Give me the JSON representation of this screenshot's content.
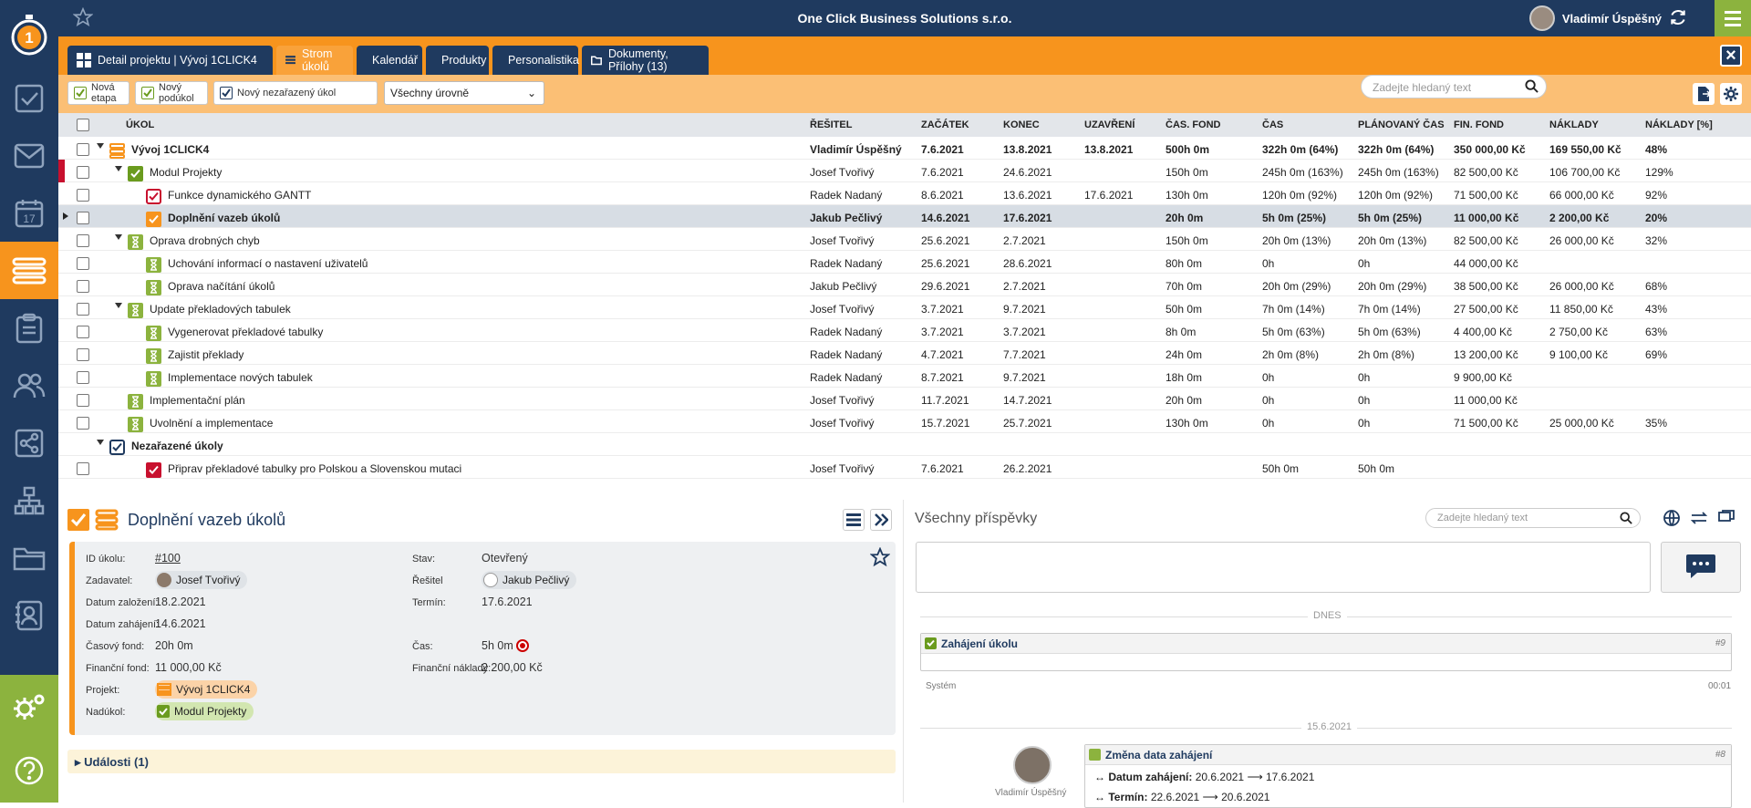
{
  "app": {
    "company": "One Click Business Solutions s.r.o.",
    "user": "Vladimír Úspěšný"
  },
  "tabs": [
    {
      "label": "Detail projektu | Vývoj 1CLICK4"
    },
    {
      "label": "Strom úkolů"
    },
    {
      "label": "Kalendář"
    },
    {
      "label": "Produkty"
    },
    {
      "label": "Personalistika"
    },
    {
      "label": "Dokumenty, Přílohy (13)"
    }
  ],
  "toolbar": {
    "new_stage": "Nová etapa",
    "new_subtask": "Nový podúkol",
    "new_unassigned": "Nový nezařazený úkol",
    "level_select": "Všechny úrovně",
    "search_placeholder": "Zadejte hledaný text"
  },
  "columns": [
    "ÚKOL",
    "ŘEŠITEL",
    "ZAČÁTEK",
    "KONEC",
    "UZAVŘENÍ",
    "ČAS. FOND",
    "ČAS",
    "PLÁNOVANÝ ČAS",
    "FIN. FOND",
    "NÁKLADY",
    "NÁKLADY [%]"
  ],
  "rows": [
    {
      "name": "Vývoj 1CLICK4",
      "solver": "Vladimír Úspěšný",
      "start": "7.6.2021",
      "end": "13.8.2021",
      "closed": "13.8.2021",
      "fund": "500h 0m",
      "time": "322h 0m (64%)",
      "planned": "322h 0m (64%)",
      "fin": "350 000,00 Kč",
      "costs": "169 550,00 Kč",
      "pct": "48%"
    },
    {
      "name": "Modul Projekty",
      "solver": "Josef Tvořivý",
      "start": "7.6.2021",
      "end": "24.6.2021",
      "closed": "",
      "fund": "150h 0m",
      "time": "245h 0m (163%)",
      "planned": "245h 0m (163%)",
      "fin": "82 500,00 Kč",
      "costs": "106 700,00 Kč",
      "pct": "129%"
    },
    {
      "name": "Funkce dynamického GANTT",
      "solver": "Radek Nadaný",
      "start": "8.6.2021",
      "end": "13.6.2021",
      "closed": "17.6.2021",
      "fund": "130h 0m",
      "time": "120h 0m (92%)",
      "planned": "120h 0m (92%)",
      "fin": "71 500,00 Kč",
      "costs": "66 000,00 Kč",
      "pct": "92%"
    },
    {
      "name": "Doplnění vazeb úkolů",
      "solver": "Jakub Pečlivý",
      "start": "14.6.2021",
      "end": "17.6.2021",
      "closed": "",
      "fund": "20h 0m",
      "time": "5h 0m (25%)",
      "planned": "5h 0m (25%)",
      "fin": "11 000,00 Kč",
      "costs": "2 200,00 Kč",
      "pct": "20%"
    },
    {
      "name": "Oprava drobných chyb",
      "solver": "Josef Tvořivý",
      "start": "25.6.2021",
      "end": "2.7.2021",
      "closed": "",
      "fund": "150h 0m",
      "time": "20h 0m (13%)",
      "planned": "20h 0m (13%)",
      "fin": "82 500,00 Kč",
      "costs": "26 000,00 Kč",
      "pct": "32%"
    },
    {
      "name": "Uchování informací o nastavení uživatelů",
      "solver": "Radek Nadaný",
      "start": "25.6.2021",
      "end": "28.6.2021",
      "closed": "",
      "fund": "80h 0m",
      "time": "0h",
      "planned": "0h",
      "fin": "44 000,00 Kč",
      "costs": "",
      "pct": ""
    },
    {
      "name": "Oprava načítání úkolů",
      "solver": "Jakub Pečlivý",
      "start": "29.6.2021",
      "end": "2.7.2021",
      "closed": "",
      "fund": "70h 0m",
      "time": "20h 0m (29%)",
      "planned": "20h 0m (29%)",
      "fin": "38 500,00 Kč",
      "costs": "26 000,00 Kč",
      "pct": "68%"
    },
    {
      "name": "Update překladových tabulek",
      "solver": "Josef Tvořivý",
      "start": "3.7.2021",
      "end": "9.7.2021",
      "closed": "",
      "fund": "50h 0m",
      "time": "7h 0m (14%)",
      "planned": "7h 0m (14%)",
      "fin": "27 500,00 Kč",
      "costs": "11 850,00 Kč",
      "pct": "43%"
    },
    {
      "name": "Vygenerovat překladové tabulky",
      "solver": "Radek Nadaný",
      "start": "3.7.2021",
      "end": "3.7.2021",
      "closed": "",
      "fund": "8h 0m",
      "time": "5h 0m (63%)",
      "planned": "5h 0m (63%)",
      "fin": "4 400,00 Kč",
      "costs": "2 750,00 Kč",
      "pct": "63%"
    },
    {
      "name": "Zajistit překlady",
      "solver": "Radek Nadaný",
      "start": "4.7.2021",
      "end": "7.7.2021",
      "closed": "",
      "fund": "24h 0m",
      "time": "2h 0m (8%)",
      "planned": "2h 0m (8%)",
      "fin": "13 200,00 Kč",
      "costs": "9 100,00 Kč",
      "pct": "69%"
    },
    {
      "name": "Implementace nových tabulek",
      "solver": "Radek Nadaný",
      "start": "8.7.2021",
      "end": "9.7.2021",
      "closed": "",
      "fund": "18h 0m",
      "time": "0h",
      "planned": "0h",
      "fin": "9 900,00 Kč",
      "costs": "",
      "pct": ""
    },
    {
      "name": "Implementační plán",
      "solver": "Josef Tvořivý",
      "start": "11.7.2021",
      "end": "14.7.2021",
      "closed": "",
      "fund": "20h 0m",
      "time": "0h",
      "planned": "0h",
      "fin": "11 000,00 Kč",
      "costs": "",
      "pct": ""
    },
    {
      "name": "Uvolnění a implementace",
      "solver": "Josef Tvořivý",
      "start": "15.7.2021",
      "end": "25.7.2021",
      "closed": "",
      "fund": "130h 0m",
      "time": "0h",
      "planned": "0h",
      "fin": "71 500,00 Kč",
      "costs": "25 000,00 Kč",
      "pct": "35%"
    },
    {
      "name": "Nezařazené úkoly",
      "solver": "",
      "start": "",
      "end": "",
      "closed": "",
      "fund": "",
      "time": "",
      "planned": "",
      "fin": "",
      "costs": "",
      "pct": ""
    },
    {
      "name": "Připrav překladové tabulky pro Polskou a Slovenskou mutaci",
      "solver": "Josef Tvořivý",
      "start": "7.6.2021",
      "end": "26.2.2021",
      "closed": "",
      "fund": "",
      "time": "50h 0m",
      "planned": "50h 0m",
      "fin": "",
      "costs": "",
      "pct": ""
    }
  ],
  "detail": {
    "title": "Doplnění vazeb úkolů",
    "labels": {
      "id": "ID úkolu:",
      "requester": "Zadavatel:",
      "created": "Datum založení:",
      "started": "Datum zahájení:",
      "fund": "Časový fond:",
      "fin_fund": "Finanční fond:",
      "project": "Projekt:",
      "parent": "Nadúkol:",
      "state": "Stav:",
      "solver": "Řešitel",
      "deadline": "Termín:",
      "time": "Čas:",
      "fin_costs": "Finanční náklady:"
    },
    "values": {
      "id": "#100",
      "requester": "Josef Tvořivý",
      "created": "18.2.2021",
      "started": "14.6.2021",
      "fund": "20h 0m",
      "fin_fund": "11 000,00 Kč",
      "project": "Vývoj 1CLICK4",
      "parent": "Modul Projekty",
      "state": "Otevřený",
      "solver": "Jakub Pečlivý",
      "deadline": "17.6.2021",
      "time": "5h 0m",
      "fin_costs": "2 200,00 Kč"
    },
    "events": "Události (1)"
  },
  "comments": {
    "title": "Všechny příspěvky",
    "search_placeholder": "Zadejte hledaný text",
    "today": "DNES",
    "date2": "15.6.2021",
    "post1": {
      "title": "Zahájení úkolu",
      "num": "#9",
      "author": "Systém",
      "time": "00:01"
    },
    "post2": {
      "title": "Změna data zahájení",
      "num": "#8",
      "author": "Vladimír Úspěšný",
      "line1_label": "Datum zahájení:",
      "line1_from": "20.6.2021",
      "line1_to": "17.6.2021",
      "line2_label": "Termín:",
      "line2_from": "22.6.2021",
      "line2_to": "20.6.2021"
    }
  }
}
